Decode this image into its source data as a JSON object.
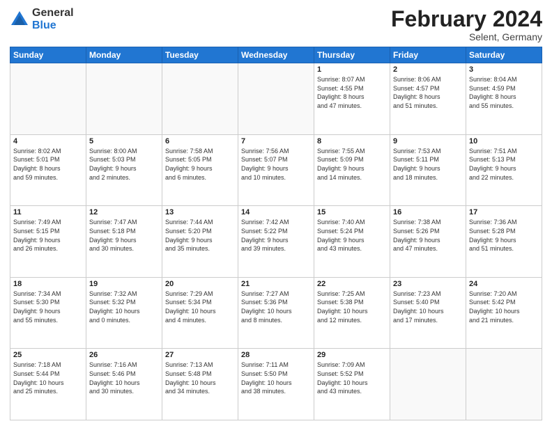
{
  "header": {
    "logo": {
      "general": "General",
      "blue": "Blue"
    },
    "title": "February 2024",
    "location": "Selent, Germany"
  },
  "days_of_week": [
    "Sunday",
    "Monday",
    "Tuesday",
    "Wednesday",
    "Thursday",
    "Friday",
    "Saturday"
  ],
  "weeks": [
    [
      {
        "day": null,
        "info": null
      },
      {
        "day": null,
        "info": null
      },
      {
        "day": null,
        "info": null
      },
      {
        "day": null,
        "info": null
      },
      {
        "day": "1",
        "info": "Sunrise: 8:07 AM\nSunset: 4:55 PM\nDaylight: 8 hours\nand 47 minutes."
      },
      {
        "day": "2",
        "info": "Sunrise: 8:06 AM\nSunset: 4:57 PM\nDaylight: 8 hours\nand 51 minutes."
      },
      {
        "day": "3",
        "info": "Sunrise: 8:04 AM\nSunset: 4:59 PM\nDaylight: 8 hours\nand 55 minutes."
      }
    ],
    [
      {
        "day": "4",
        "info": "Sunrise: 8:02 AM\nSunset: 5:01 PM\nDaylight: 8 hours\nand 59 minutes."
      },
      {
        "day": "5",
        "info": "Sunrise: 8:00 AM\nSunset: 5:03 PM\nDaylight: 9 hours\nand 2 minutes."
      },
      {
        "day": "6",
        "info": "Sunrise: 7:58 AM\nSunset: 5:05 PM\nDaylight: 9 hours\nand 6 minutes."
      },
      {
        "day": "7",
        "info": "Sunrise: 7:56 AM\nSunset: 5:07 PM\nDaylight: 9 hours\nand 10 minutes."
      },
      {
        "day": "8",
        "info": "Sunrise: 7:55 AM\nSunset: 5:09 PM\nDaylight: 9 hours\nand 14 minutes."
      },
      {
        "day": "9",
        "info": "Sunrise: 7:53 AM\nSunset: 5:11 PM\nDaylight: 9 hours\nand 18 minutes."
      },
      {
        "day": "10",
        "info": "Sunrise: 7:51 AM\nSunset: 5:13 PM\nDaylight: 9 hours\nand 22 minutes."
      }
    ],
    [
      {
        "day": "11",
        "info": "Sunrise: 7:49 AM\nSunset: 5:15 PM\nDaylight: 9 hours\nand 26 minutes."
      },
      {
        "day": "12",
        "info": "Sunrise: 7:47 AM\nSunset: 5:18 PM\nDaylight: 9 hours\nand 30 minutes."
      },
      {
        "day": "13",
        "info": "Sunrise: 7:44 AM\nSunset: 5:20 PM\nDaylight: 9 hours\nand 35 minutes."
      },
      {
        "day": "14",
        "info": "Sunrise: 7:42 AM\nSunset: 5:22 PM\nDaylight: 9 hours\nand 39 minutes."
      },
      {
        "day": "15",
        "info": "Sunrise: 7:40 AM\nSunset: 5:24 PM\nDaylight: 9 hours\nand 43 minutes."
      },
      {
        "day": "16",
        "info": "Sunrise: 7:38 AM\nSunset: 5:26 PM\nDaylight: 9 hours\nand 47 minutes."
      },
      {
        "day": "17",
        "info": "Sunrise: 7:36 AM\nSunset: 5:28 PM\nDaylight: 9 hours\nand 51 minutes."
      }
    ],
    [
      {
        "day": "18",
        "info": "Sunrise: 7:34 AM\nSunset: 5:30 PM\nDaylight: 9 hours\nand 55 minutes."
      },
      {
        "day": "19",
        "info": "Sunrise: 7:32 AM\nSunset: 5:32 PM\nDaylight: 10 hours\nand 0 minutes."
      },
      {
        "day": "20",
        "info": "Sunrise: 7:29 AM\nSunset: 5:34 PM\nDaylight: 10 hours\nand 4 minutes."
      },
      {
        "day": "21",
        "info": "Sunrise: 7:27 AM\nSunset: 5:36 PM\nDaylight: 10 hours\nand 8 minutes."
      },
      {
        "day": "22",
        "info": "Sunrise: 7:25 AM\nSunset: 5:38 PM\nDaylight: 10 hours\nand 12 minutes."
      },
      {
        "day": "23",
        "info": "Sunrise: 7:23 AM\nSunset: 5:40 PM\nDaylight: 10 hours\nand 17 minutes."
      },
      {
        "day": "24",
        "info": "Sunrise: 7:20 AM\nSunset: 5:42 PM\nDaylight: 10 hours\nand 21 minutes."
      }
    ],
    [
      {
        "day": "25",
        "info": "Sunrise: 7:18 AM\nSunset: 5:44 PM\nDaylight: 10 hours\nand 25 minutes."
      },
      {
        "day": "26",
        "info": "Sunrise: 7:16 AM\nSunset: 5:46 PM\nDaylight: 10 hours\nand 30 minutes."
      },
      {
        "day": "27",
        "info": "Sunrise: 7:13 AM\nSunset: 5:48 PM\nDaylight: 10 hours\nand 34 minutes."
      },
      {
        "day": "28",
        "info": "Sunrise: 7:11 AM\nSunset: 5:50 PM\nDaylight: 10 hours\nand 38 minutes."
      },
      {
        "day": "29",
        "info": "Sunrise: 7:09 AM\nSunset: 5:52 PM\nDaylight: 10 hours\nand 43 minutes."
      },
      {
        "day": null,
        "info": null
      },
      {
        "day": null,
        "info": null
      }
    ]
  ]
}
